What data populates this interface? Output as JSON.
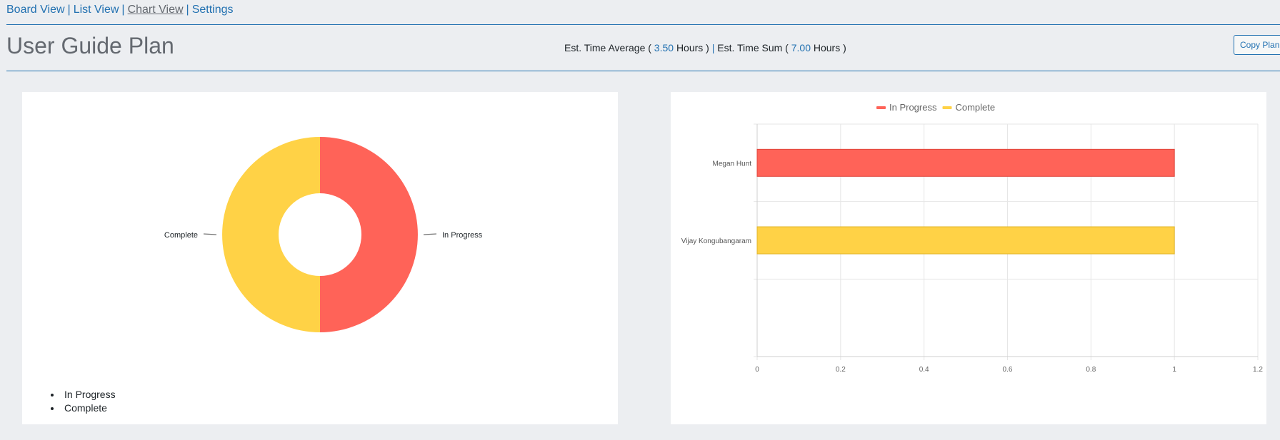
{
  "nav": {
    "board_view": "Board View",
    "list_view": "List View",
    "chart_view": "Chart View",
    "settings": "Settings",
    "separator": "|"
  },
  "page": {
    "title": "User Guide Plan",
    "est_avg_label": "Est. Time Average (",
    "est_avg_value": "3.50",
    "est_avg_unit": "Hours )",
    "est_divider": "|",
    "est_sum_label": "Est. Time Sum (",
    "est_sum_value": "7.00",
    "est_sum_unit": "Hours )",
    "copy_button": "Copy Plan Link"
  },
  "colors": {
    "in_progress": "#ff6358",
    "complete": "#ffd246",
    "link": "#2271b1"
  },
  "chart_data": [
    {
      "type": "pie",
      "variant": "donut",
      "categories": [
        "In Progress",
        "Complete"
      ],
      "values": [
        1,
        1
      ],
      "slice_labels": [
        "In Progress",
        "Complete"
      ],
      "legend": {
        "placement": "bottom-left",
        "entries": [
          "In Progress",
          "Complete"
        ]
      }
    },
    {
      "type": "bar",
      "orientation": "horizontal",
      "categories": [
        "Megan Hunt",
        "Vijay Kongubangaram"
      ],
      "series": [
        {
          "name": "In Progress",
          "values": [
            1,
            0
          ]
        },
        {
          "name": "Complete",
          "values": [
            0,
            1
          ]
        }
      ],
      "xlim": [
        0,
        1.2
      ],
      "xticks": [
        "0",
        "0.2",
        "0.4",
        "0.6",
        "0.8",
        "1",
        "1.2"
      ],
      "grid": true,
      "legend": {
        "placement": "top-center",
        "entries": [
          "In Progress",
          "Complete"
        ]
      }
    }
  ]
}
